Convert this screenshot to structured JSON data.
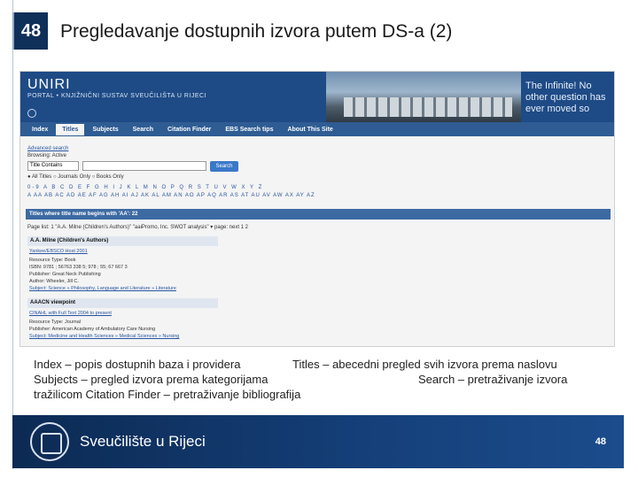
{
  "slide": {
    "number": "48",
    "title": "Pregledavanje dostupnih izvora putem DS-a (2)"
  },
  "screenshot": {
    "banner_logo": "UNIRI",
    "banner_sub": "PORTAL • KNJIŽNIČNI SUSTAV SVEUČILIŠTA U RIJECI",
    "banner_quote": "The Infinite! No other question has ever moved so",
    "nav_tabs": [
      "Index",
      "Titles",
      "Subjects",
      "Search",
      "Citation Finder",
      "EBS Search tips",
      "About This Site"
    ],
    "advanced_search": "Advanced search",
    "browsing": "Browsing: Active",
    "select_value": "Title Contains",
    "search_button": "Search",
    "radio_options": "● All Titles   ○ Journals Only   ○ Books Only",
    "alphabet_1": "0-9 A B C D E F G H I J K L M N O P Q R S T U V W X Y Z",
    "alphabet_2": "A AA AB AC AD AE AF AG AH AI AJ AK AL AM AN AO AP AQ AR AS AT AU AV AW AX AY AZ",
    "results_bar": "Titles where title name begins with 'AA': 22",
    "pager": "Page list: 1 \"A.A. Milne (Children's Authors)\" \"aaiPromo, Inc. SWOT analysis\" ▾  page: next 1 2",
    "records": [
      {
        "title": "A.A. Milne (Children's Authors)",
        "lines": [
          "Yankee/EBSCO Host  2001",
          "Resource Type: Book",
          "ISBN: 9781 ; 56763 338 5; 978 ; 55; 67 667 3",
          "Publisher: Great Neck Publishing",
          "Author: Wheeler, Jill C.",
          "Subject: Science » Philosophy, Language and Literature » Literature"
        ]
      },
      {
        "title": "AAACN viewpoint",
        "lines": [
          "CINAHL with Full Text  2004 to present",
          "Resource Type: Journal",
          "Publisher: American Academy of Ambulatory Care Nursing",
          "Subject: Medicine and Health Sciences » Medical Sciences » Nursing"
        ]
      }
    ]
  },
  "captions": {
    "line1_left": "Index – popis dostupnih baza i providera",
    "line1_right": "Titles – abecedni pregled svih izvora prema naslovu",
    "line2_left": "Subjects – pregled izvora prema kategorijama",
    "line2_right": "Search – pretraživanje izvora",
    "line3": "tražilicom Citation Finder – pretraživanje bibliografija"
  },
  "footer": {
    "university": "Sveučilište u Rijeci",
    "page_number": "48"
  }
}
